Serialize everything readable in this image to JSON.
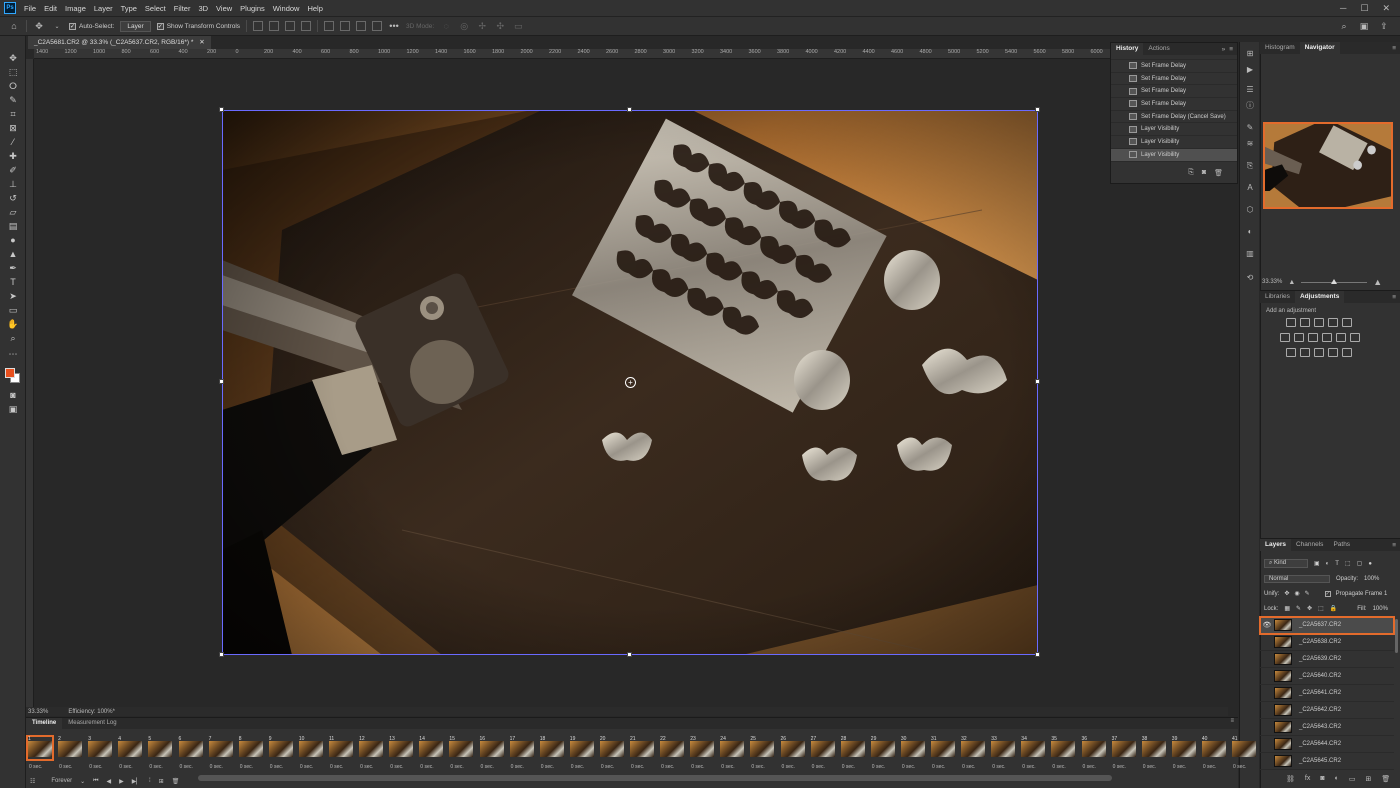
{
  "menubar": {
    "app_logo": "Ps",
    "items": [
      "File",
      "Edit",
      "Image",
      "Layer",
      "Type",
      "Select",
      "Filter",
      "3D",
      "View",
      "Plugins",
      "Window",
      "Help"
    ]
  },
  "options": {
    "auto_select_label": "Auto-Select:",
    "auto_select_value": "Layer",
    "transform_label": "Show Transform Controls",
    "mode_3d": "3D Mode:"
  },
  "document": {
    "tab_title": "_C2A5681.CR2 @ 33.3% (_C2A5637.CR2, RGB/16*) *",
    "ruler_labels": [
      "1400",
      "1200",
      "1000",
      "800",
      "600",
      "400",
      "200",
      "0",
      "200",
      "400",
      "600",
      "800",
      "1000",
      "1200",
      "1400",
      "1600",
      "1800",
      "2000",
      "2200",
      "2400",
      "2600",
      "2800",
      "3000",
      "3200",
      "3400",
      "3600",
      "3800",
      "4000",
      "4200",
      "4400",
      "4600",
      "4800",
      "5000",
      "5200",
      "5400",
      "5600",
      "5800",
      "6000",
      "6200",
      "6400",
      "6600",
      "6800",
      "7000"
    ],
    "status_zoom": "33.33%",
    "status_efficiency": "Efficiency: 100%*"
  },
  "history": {
    "tabs": [
      "History",
      "Actions"
    ],
    "rows": [
      "Set Frame Delay",
      "Set Frame Delay",
      "Set Frame Delay",
      "Set Frame Delay",
      "Set Frame Delay (Cancel Save)",
      "Layer Visibility",
      "Layer Visibility",
      "Layer Visibility"
    ]
  },
  "navigator": {
    "tabs": [
      "Histogram",
      "Navigator"
    ],
    "zoom": "33.33%"
  },
  "adjustments": {
    "tabs": [
      "Libraries",
      "Adjustments"
    ],
    "hint": "Add an adjustment"
  },
  "layers": {
    "tabs": [
      "Layers",
      "Channels",
      "Paths"
    ],
    "kind": "Kind",
    "blend_mode": "Normal",
    "opacity_label": "Opacity:",
    "opacity_value": "100%",
    "unify_label": "Unify:",
    "propagate_label": "Propagate Frame 1",
    "lock_label": "Lock:",
    "fill_label": "Fill:",
    "fill_value": "100%",
    "items": [
      "_C2A5637.CR2",
      "_C2A5638.CR2",
      "_C2A5639.CR2",
      "_C2A5640.CR2",
      "_C2A5641.CR2",
      "_C2A5642.CR2",
      "_C2A5643.CR2",
      "_C2A5644.CR2",
      "_C2A5645.CR2"
    ]
  },
  "timeline": {
    "tabs": [
      "Timeline",
      "Measurement Log"
    ],
    "loop": "Forever",
    "frame_delay": "0 sec.",
    "frame_count": 41
  },
  "colors": {
    "accent": "#e36b2c",
    "foreground": "#e8501e",
    "background": "#ffffff"
  }
}
